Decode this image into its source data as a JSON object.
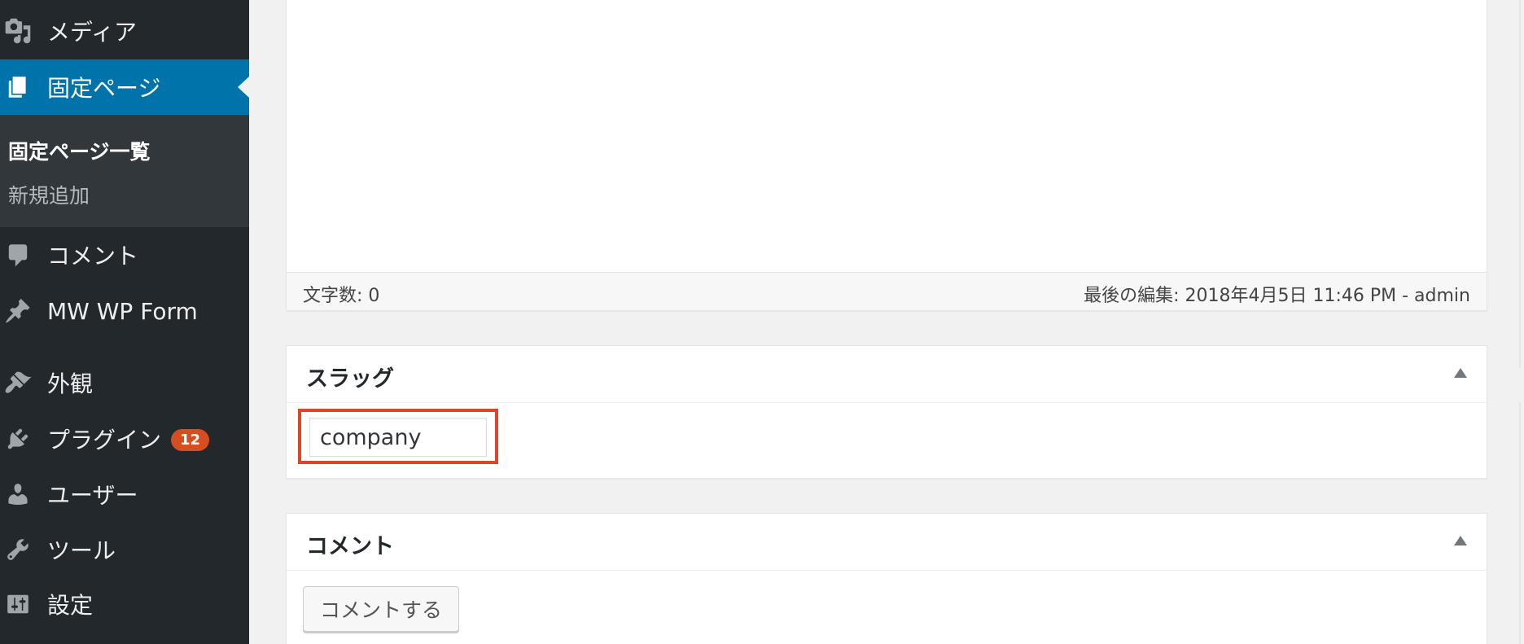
{
  "sidebar": {
    "items": [
      {
        "label": "メディア",
        "icon": "media-icon"
      },
      {
        "label": "固定ページ",
        "icon": "pages-icon"
      },
      {
        "label": "コメント",
        "icon": "comment-icon"
      },
      {
        "label": "MW WP Form",
        "icon": "pin-icon"
      },
      {
        "label": "外観",
        "icon": "appearance-icon"
      },
      {
        "label": "プラグイン",
        "icon": "plugin-icon",
        "badge": "12"
      },
      {
        "label": "ユーザー",
        "icon": "user-icon"
      },
      {
        "label": "ツール",
        "icon": "wrench-icon"
      },
      {
        "label": "設定",
        "icon": "settings-icon"
      }
    ],
    "active_item": "固定ページ",
    "submenu": {
      "current": "固定ページ一覧",
      "add_new": "新規追加"
    }
  },
  "editor": {
    "word_count": "文字数: 0",
    "last_edited": "最後の編集: 2018年4月5日 11:46 PM - admin"
  },
  "slug_box": {
    "title": "スラッグ",
    "value": "company"
  },
  "comment_box": {
    "title": "コメント",
    "button_label": "コメントする"
  },
  "colors": {
    "sidebar_bg": "#23282d",
    "active_bg": "#0073aa",
    "badge_bg": "#d54e21",
    "highlight_border": "#e0442a"
  }
}
